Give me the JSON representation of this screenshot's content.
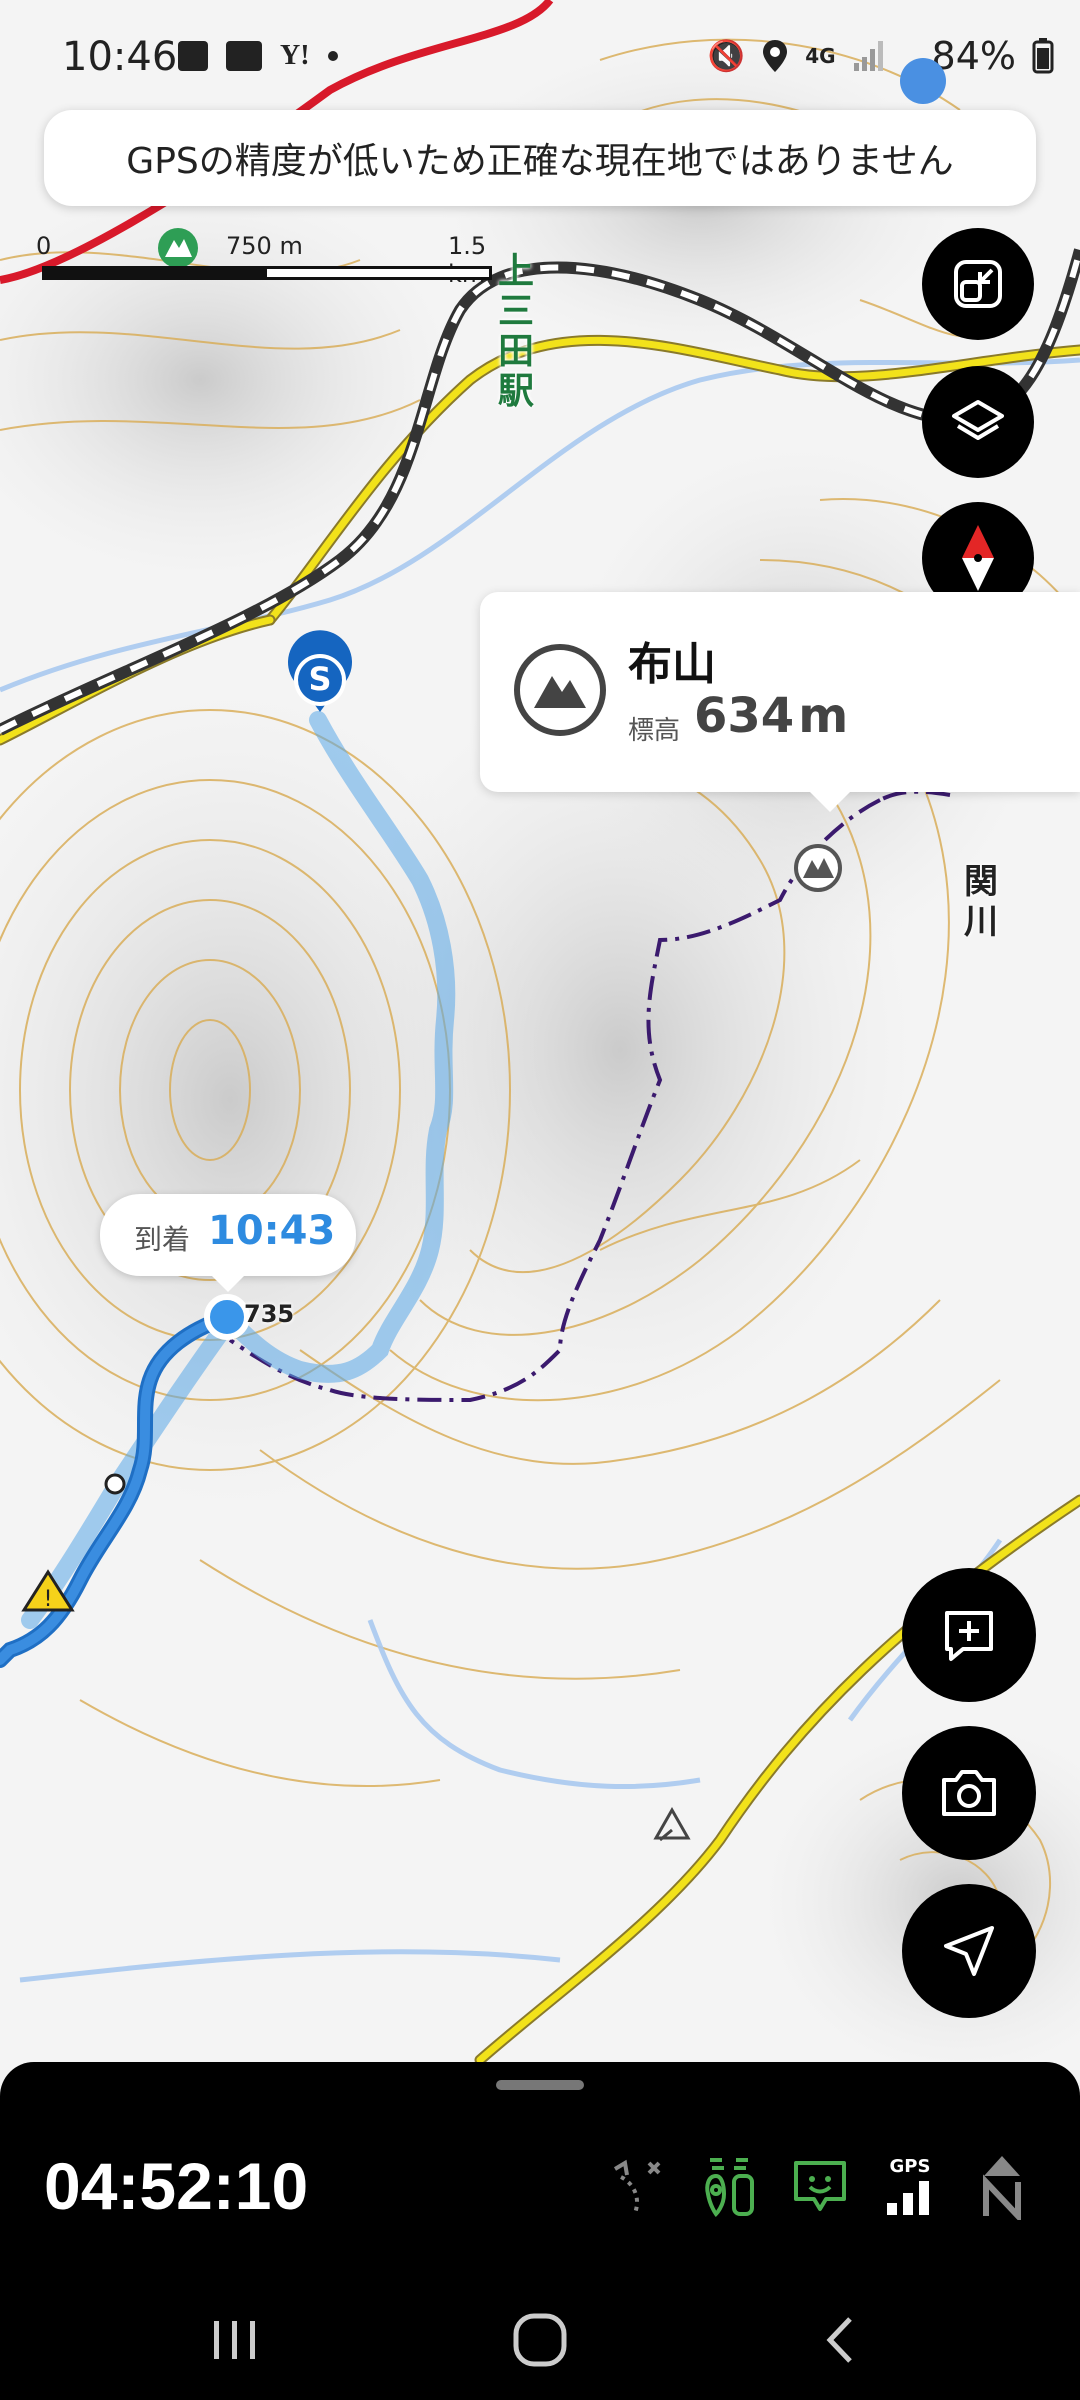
{
  "status_bar": {
    "time": "10:46",
    "network": "4G",
    "battery": "84%",
    "icons": [
      "image-icon",
      "shuffle-icon",
      "yahoo-icon",
      "dot-icon",
      "mute-icon",
      "location-icon",
      "network-icon",
      "signal-icon",
      "battery-icon"
    ]
  },
  "gps_warning": "GPSの精度が低いため正確な現在地ではありません",
  "scale": {
    "start": "0",
    "mid": "750 m",
    "end": "1.5 km"
  },
  "map_labels": {
    "station": "上三田駅",
    "river": "関川",
    "elevation_point": "735",
    "start_marker": "S"
  },
  "poi": {
    "name": "布山",
    "elevation_label": "標高",
    "elevation_value": "634",
    "elevation_unit": "m"
  },
  "arrival": {
    "label": "到着",
    "time": "10:43"
  },
  "bottom_panel": {
    "elapsed_time": "04:52:10",
    "gps_label": "GPS"
  },
  "colors": {
    "accent_blue": "#2e8be0",
    "route_blue": "#5aa8e8",
    "trail_purple": "#3b1a6e",
    "road_yellow": "#f2e21a",
    "contour": "#d9ae5a",
    "river": "#a9c9f0",
    "green_active": "#4caf50"
  }
}
